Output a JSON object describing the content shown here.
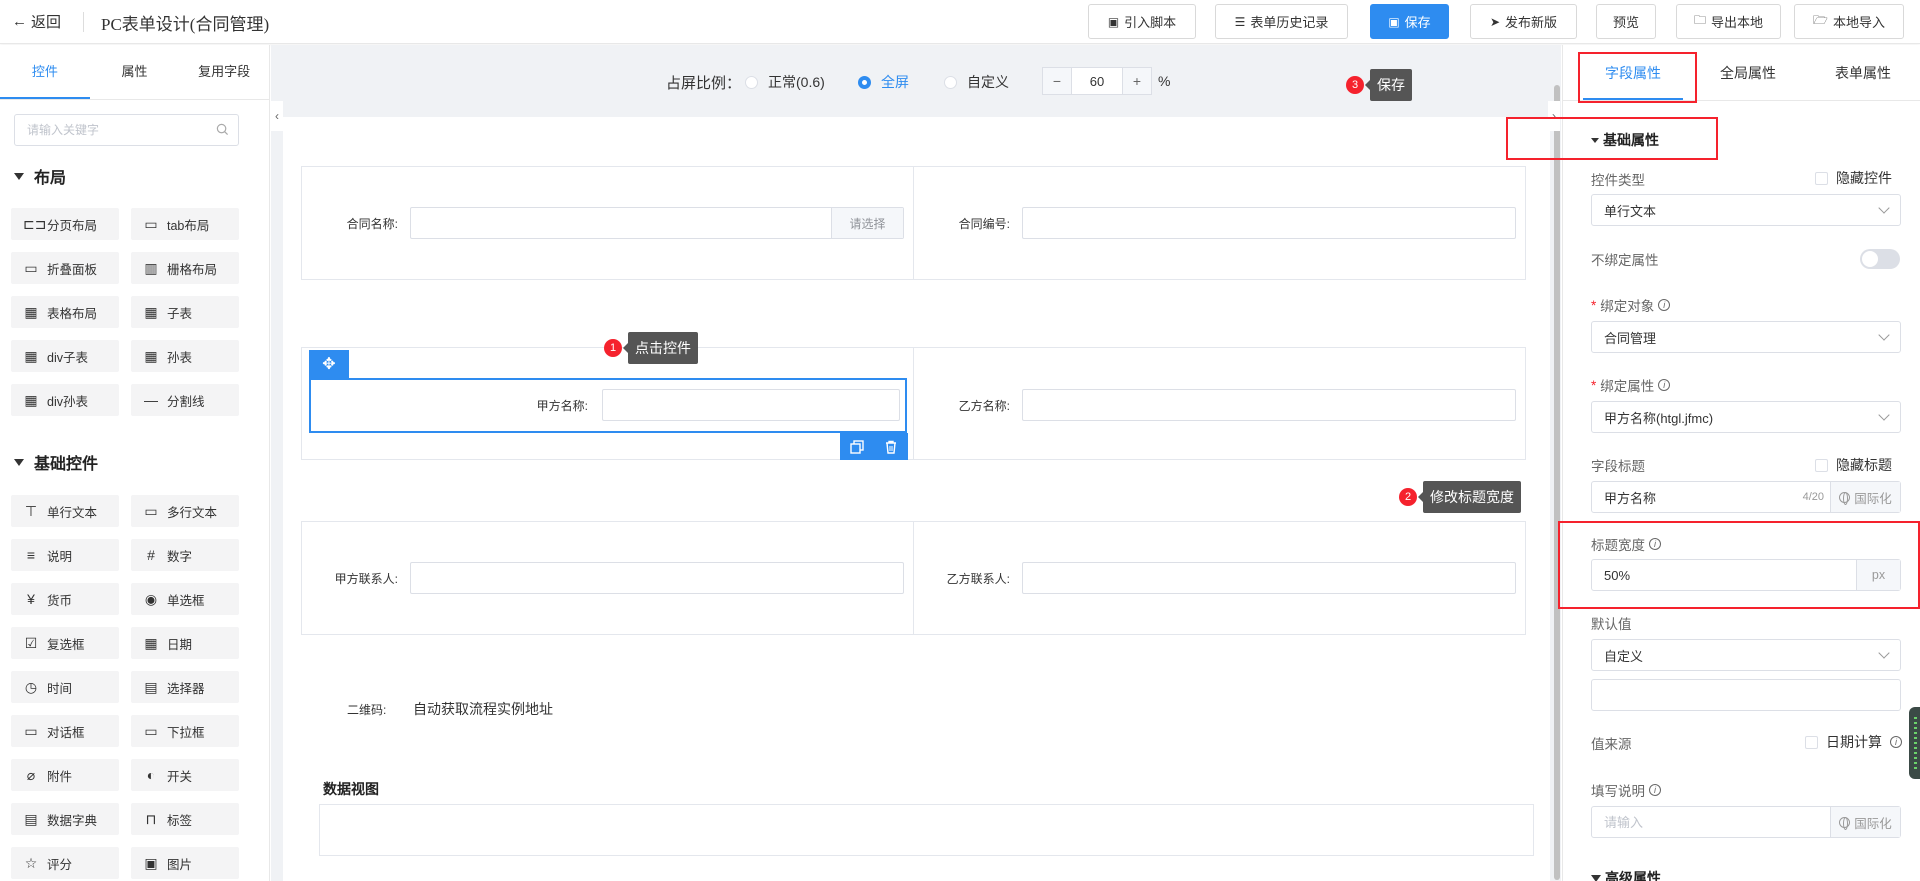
{
  "header": {
    "back_label": "返回",
    "title": "PC表单设计(合同管理)",
    "buttons": {
      "import_script": "引入脚本",
      "history": "表单历史记录",
      "save": "保存",
      "publish": "发布新版",
      "preview": "预览",
      "export_local": "导出本地",
      "import_local": "本地导入"
    }
  },
  "left_panel": {
    "tabs": [
      "控件",
      "属性",
      "复用字段"
    ],
    "active_tab": "控件",
    "search_placeholder": "请输入关键字",
    "layout_section": "布局",
    "layout_items": [
      {
        "label": "分页布局",
        "icon": "page-layout-icon"
      },
      {
        "label": "tab布局",
        "icon": "tab-layout-icon"
      },
      {
        "label": "折叠面板",
        "icon": "collapse-panel-icon"
      },
      {
        "label": "栅格布局",
        "icon": "grid-layout-icon"
      },
      {
        "label": "表格布局",
        "icon": "table-layout-icon"
      },
      {
        "label": "子表",
        "icon": "subtable-icon"
      },
      {
        "label": "div子表",
        "icon": "div-subtable-icon"
      },
      {
        "label": "孙表",
        "icon": "grandchild-table-icon"
      },
      {
        "label": "div孙表",
        "icon": "div-grandchild-table-icon"
      },
      {
        "label": "分割线",
        "icon": "divider-icon"
      }
    ],
    "basic_section": "基础控件",
    "basic_items": [
      {
        "label": "单行文本",
        "icon": "single-line-text-icon"
      },
      {
        "label": "多行文本",
        "icon": "multi-line-text-icon"
      },
      {
        "label": "说明",
        "icon": "description-icon"
      },
      {
        "label": "数字",
        "icon": "number-icon"
      },
      {
        "label": "货币",
        "icon": "currency-icon"
      },
      {
        "label": "单选框",
        "icon": "radio-icon"
      },
      {
        "label": "复选框",
        "icon": "checkbox-icon"
      },
      {
        "label": "日期",
        "icon": "calendar-icon"
      },
      {
        "label": "时间",
        "icon": "clock-icon"
      },
      {
        "label": "选择器",
        "icon": "selector-icon"
      },
      {
        "label": "对话框",
        "icon": "dialog-icon"
      },
      {
        "label": "下拉框",
        "icon": "dropdown-icon"
      },
      {
        "label": "附件",
        "icon": "attachment-icon"
      },
      {
        "label": "开关",
        "icon": "switch-icon"
      },
      {
        "label": "数据字典",
        "icon": "dictionary-icon"
      },
      {
        "label": "标签",
        "icon": "tag-icon"
      },
      {
        "label": "评分",
        "icon": "rating-icon"
      },
      {
        "label": "图片",
        "icon": "image-icon"
      }
    ]
  },
  "canvas": {
    "ratio_label": "占屏比例：",
    "ratio_options": [
      "正常(0.6)",
      "全屏",
      "自定义"
    ],
    "ratio_selected": "全屏",
    "custom_value": "60",
    "minus": "−",
    "plus": "+",
    "percent_sign": "%",
    "fields": {
      "contract_name": "合同名称:",
      "contract_name_addon": "请选择",
      "contract_no": "合同编号:",
      "party_a_name": "甲方名称:",
      "party_b_name": "乙方名称:",
      "party_a_contact": "甲方联系人:",
      "party_b_contact": "乙方联系人:"
    },
    "qrcode_label": "二维码:",
    "qrcode_value": "自动获取流程实例地址",
    "data_view_title": "数据视图",
    "annotations": [
      {
        "num": "1",
        "text": "点击控件"
      },
      {
        "num": "2",
        "text": "修改标题宽度"
      },
      {
        "num": "3",
        "text": "保存"
      }
    ]
  },
  "right_panel": {
    "tabs": [
      "字段属性",
      "全局属性",
      "表单属性"
    ],
    "active_tab": "字段属性",
    "section_basic": "基础属性",
    "control_type_label": "控件类型",
    "hide_control_label": "隐藏控件",
    "control_type_value": "单行文本",
    "unbind_label": "不绑定属性",
    "bind_object_label": "绑定对象",
    "bind_object_value": "合同管理",
    "bind_attr_label": "绑定属性",
    "bind_attr_value": "甲方名称(htgl.jfmc)",
    "field_title_label": "字段标题",
    "hide_title_label": "隐藏标题",
    "field_title_value": "甲方名称",
    "field_title_count": "4/20",
    "i18n_label": "国际化",
    "title_width_label": "标题宽度",
    "title_width_value": "50%",
    "title_width_unit": "px",
    "default_value_label": "默认值",
    "default_value_select": "自定义",
    "value_source_label": "值来源",
    "date_calc_label": "日期计算",
    "fill_desc_label": "填写说明",
    "fill_desc_placeholder": "请输入",
    "section_advanced": "高级属性"
  }
}
